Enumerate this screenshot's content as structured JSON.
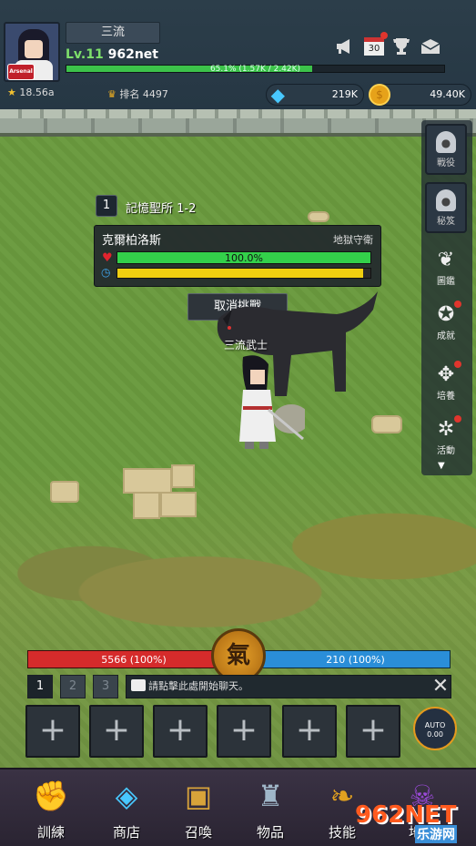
{
  "player": {
    "rank_title": "三流",
    "level_label": "Lv.11",
    "name": "962net",
    "xp_percent": 65.1,
    "xp_text": "65.1% (1.57K / 2.42K)",
    "stat_left": "18.56a",
    "rank_label": "排名",
    "rank_value": "4497",
    "avatar_badge": "Arsenal"
  },
  "currency": {
    "gems": "219K",
    "gold": "49.40K"
  },
  "top_icons": [
    "megaphone-icon",
    "calendar-icon",
    "trophy-icon",
    "mail-icon"
  ],
  "calendar_day": "30",
  "side_menu": {
    "locked": [
      {
        "label": "戰役"
      },
      {
        "label": "秘笈"
      }
    ],
    "items": [
      {
        "label": "圖鑑",
        "icon": "feather-icon",
        "dot": false
      },
      {
        "label": "成就",
        "icon": "medal-icon",
        "dot": true
      },
      {
        "label": "培養",
        "icon": "arrows-icon",
        "dot": true
      },
      {
        "label": "活動",
        "icon": "party-icon",
        "dot": true
      }
    ]
  },
  "stage": {
    "number": "1",
    "name": "記憶聖所 1-2"
  },
  "boss": {
    "name": "克爾柏洛斯",
    "title": "地獄守衛",
    "hp_percent": 100.0,
    "hp_text": "100.0%",
    "time_fraction": 0.97
  },
  "cancel_label": "取消挑戰",
  "hero_label": "三流武士",
  "combat": {
    "hp_text": "5566 (100%)",
    "mp_text": "210 (100%)",
    "qi_glyph": "氣"
  },
  "chat": {
    "tabs": [
      "1",
      "2",
      "3"
    ],
    "active_tab": 0,
    "placeholder": "請點擊此處開始聊天。"
  },
  "skill_slots": [
    "+",
    "+",
    "+",
    "+",
    "+",
    "+"
  ],
  "auto": {
    "label": "AUTO",
    "value": "0.00"
  },
  "nav": [
    {
      "label": "訓練",
      "icon": "gauntlet-icon"
    },
    {
      "label": "商店",
      "icon": "shop-icon"
    },
    {
      "label": "召喚",
      "icon": "chest-icon"
    },
    {
      "label": "物品",
      "icon": "armor-icon"
    },
    {
      "label": "技能",
      "icon": "scroll-icon"
    },
    {
      "label": "地獄",
      "icon": "demon-icon"
    }
  ],
  "watermark": {
    "main": "962NET",
    "sub": "乐游网"
  },
  "colors": {
    "hp": "#d52b2b",
    "mp": "#2a8ed8",
    "xp": "#3cc24a",
    "boss_hp": "#33d04a",
    "timer": "#f0cf10",
    "gold": "#e6a21a",
    "gem": "#48c8ff"
  }
}
